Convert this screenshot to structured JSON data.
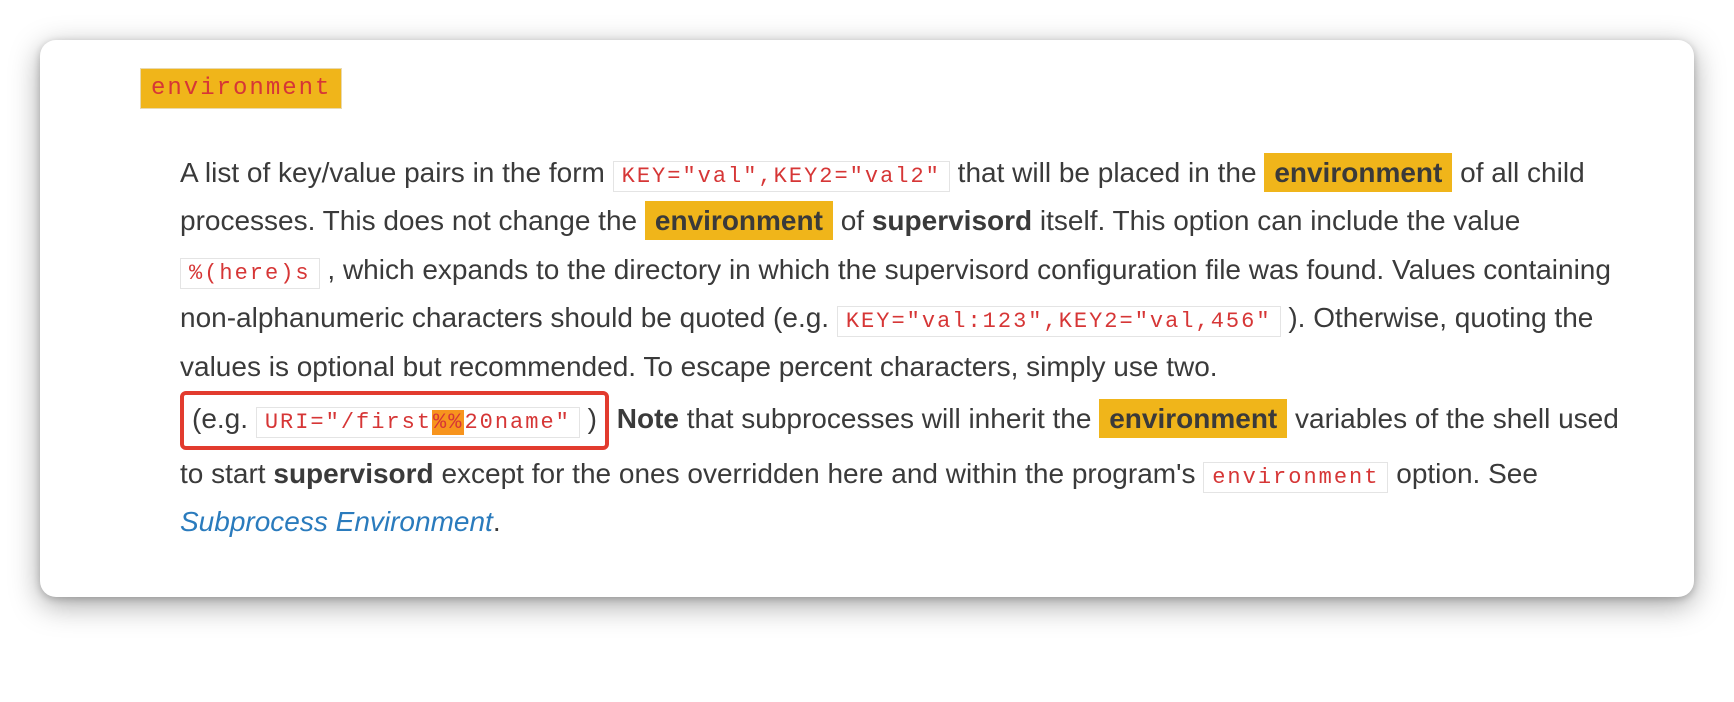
{
  "term": "environment",
  "description": {
    "t1": "A list of key/value pairs in the form ",
    "code1": "KEY=\"val\",KEY2=\"val2\"",
    "t2": " that will be placed in the ",
    "hl1": "environment",
    "t3": " of all child processes. This does not change the ",
    "hl2": "environment",
    "t4": " of ",
    "bold1": "supervisord",
    "t5": " itself. This option can include the value ",
    "code2": "%(here)s",
    "t6": ", which expands to the directory in which the supervisord configuration file was found. Values containing non-alphanumeric characters should be quoted (e.g. ",
    "code3": "KEY=\"val:123\",KEY2=\"val,456\"",
    "t7": "). Otherwise, quoting the values is optional but recommended. To escape percent characters, simply use two. ",
    "annot_eg": "(e.g. ",
    "annot_code_a": "URI=\"/first",
    "annot_code_hl": "%%",
    "annot_code_b": "20name\"",
    "annot_close": ")",
    "t8": " ",
    "bold2": "Note",
    "t9": " that subprocesses will inherit the ",
    "hl3": "environment",
    "t10": " variables of the shell used to start ",
    "bold3": "supervisord",
    "t11": " except for the ones overridden here and within the program's ",
    "code4": "environment",
    "t12": " option. See ",
    "link": "Subprocess Environment",
    "t13": "."
  }
}
